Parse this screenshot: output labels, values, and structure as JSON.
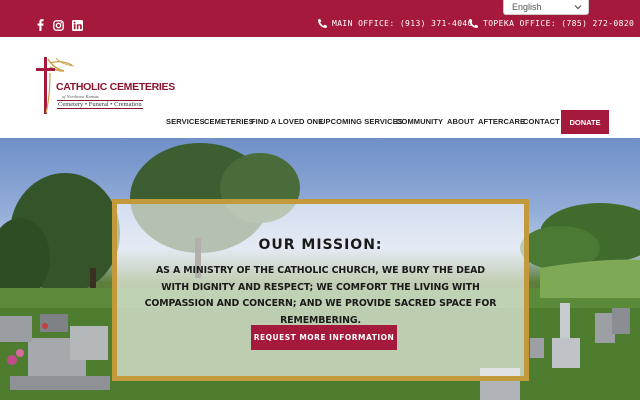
{
  "topbar": {
    "social_icons": [
      "facebook-icon",
      "instagram-icon",
      "linkedin-icon"
    ],
    "main_office": "MAIN OFFICE: (913) 371-4040",
    "topeka_office": "TOPEKA OFFICE: (785) 272-0820",
    "language": "English"
  },
  "logo": {
    "title": "CATHOLIC CEMETERIES",
    "subtitle": "of Northeast Kansas",
    "tagline": "Cemetery • Funeral • Cremation"
  },
  "nav": {
    "items": [
      "SERVICES",
      "CEMETERIES",
      "FIND A LOVED ONE",
      "UPCOMING SERVICES",
      "COMMUNITY",
      "ABOUT",
      "AFTERCARE",
      "CONTACT"
    ],
    "donate": "DONATE"
  },
  "mission": {
    "title": "OUR MISSION:",
    "text": "AS A MINISTRY OF THE CATHOLIC CHURCH, WE BURY THE DEAD WITH DIGNITY AND RESPECT; WE COMFORT THE LIVING WITH COMPASSION AND CONCERN; AND WE PROVIDE SACRED SPACE FOR REMEMBERING.",
    "cta": "REQUEST MORE INFORMATION"
  },
  "colors": {
    "brand": "#a51a3c",
    "gold": "#c29a3b"
  }
}
